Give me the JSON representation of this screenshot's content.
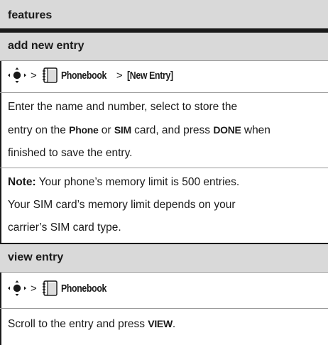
{
  "header": {
    "title": "features"
  },
  "sections": [
    {
      "title": "add new entry",
      "path": {
        "sep": ">",
        "item1": "Phonebook",
        "sep2": ">",
        "item2": "[New Entry]"
      },
      "body": {
        "p1_a": "Enter the name and number, select to store the",
        "p1_b": "entry on the ",
        "kw_phone": "Phone",
        "p1_c": " or ",
        "kw_sim": "SIM",
        "p1_d": " card, and press ",
        "kw_done": "DONE",
        "p1_e": " when",
        "p1_f": "finished to save the entry.",
        "note_label": "Note:",
        "note_a": " Your phone’s memory limit is 500 entries.",
        "note_b": "Your SIM card’s memory limit depends on your",
        "note_c": "carrier’s SIM card type."
      }
    },
    {
      "title": "view entry",
      "path": {
        "sep": ">",
        "item1": "Phonebook"
      },
      "body": {
        "p1_a": "Scroll to the entry and press ",
        "kw_view": "VIEW",
        "p1_b": "."
      }
    }
  ],
  "icons": [
    "nav-key-icon",
    "phonebook-icon"
  ]
}
